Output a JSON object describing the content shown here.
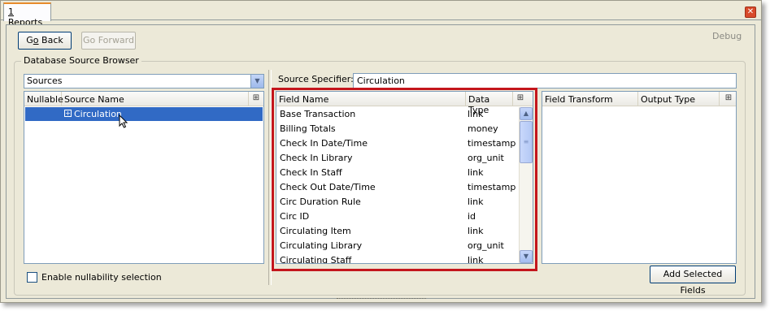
{
  "tab": {
    "mnemonic": "1",
    "label": " Reports"
  },
  "close_glyph": "✕",
  "toolbar": {
    "go_back_mn": "o",
    "go_back_pre": "G",
    "go_back_post": " Back",
    "go_forward_label": "Go Forward",
    "debug": "Debug"
  },
  "browser": {
    "title": "Database Source Browser",
    "sources_combo": "Sources",
    "columns": [
      "Nullable",
      "Source Name"
    ],
    "tree": [
      {
        "label": "Circulation",
        "expanded": false
      }
    ],
    "nullability_checkbox": "Enable nullability selection",
    "nullability_checked": false
  },
  "source": {
    "label": "Source Specifier:",
    "value": "Circulation"
  },
  "fields": {
    "columns": [
      "Field Name",
      "Data Type"
    ],
    "rows": [
      {
        "name": "Base Transaction",
        "type": "link"
      },
      {
        "name": "Billing Totals",
        "type": "money"
      },
      {
        "name": "Check In Date/Time",
        "type": "timestamp"
      },
      {
        "name": "Check In Library",
        "type": "org_unit"
      },
      {
        "name": "Check In Staff",
        "type": "link"
      },
      {
        "name": "Check Out Date/Time",
        "type": "timestamp"
      },
      {
        "name": "Circ Duration Rule",
        "type": "link"
      },
      {
        "name": "Circ ID",
        "type": "id"
      },
      {
        "name": "Circulating Item",
        "type": "link"
      },
      {
        "name": "Circulating Library",
        "type": "org_unit"
      },
      {
        "name": "Circulating Staff",
        "type": "link"
      }
    ]
  },
  "transforms": {
    "columns": [
      "Field Transform",
      "Output Type"
    ],
    "add_button": "Add Selected Fields"
  },
  "colors": {
    "highlight": "#c4161c",
    "selection": "#316ac5"
  }
}
